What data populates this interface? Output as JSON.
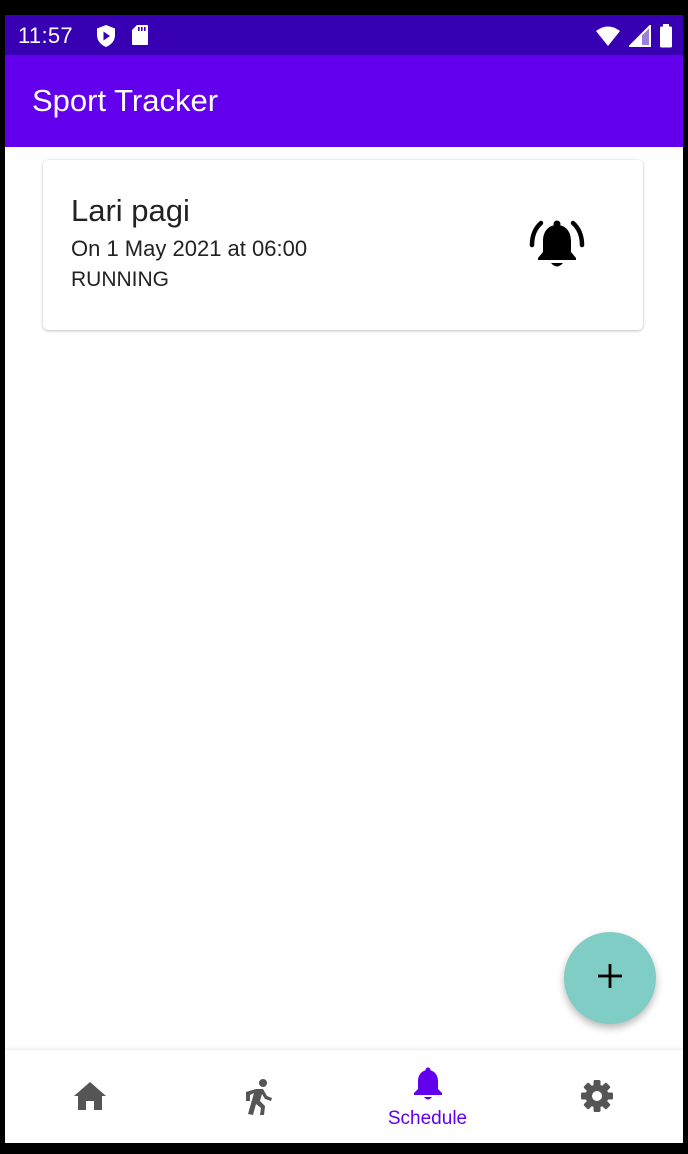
{
  "status_bar": {
    "time": "11:57",
    "icons": [
      "play-protect-icon",
      "sd-card-icon",
      "wifi-icon",
      "signal-icon",
      "battery-icon"
    ]
  },
  "app_bar": {
    "title": "Sport Tracker"
  },
  "schedule": {
    "items": [
      {
        "title": "Lari pagi",
        "date": "On 1 May 2021 at 06:00",
        "type": "RUNNING",
        "icon": "alarm-bell-icon"
      }
    ]
  },
  "fab": {
    "icon": "plus-icon"
  },
  "bottom_nav": {
    "items": [
      {
        "id": "home",
        "icon": "home-icon",
        "label": "",
        "selected": false
      },
      {
        "id": "run",
        "icon": "run-icon",
        "label": "",
        "selected": false
      },
      {
        "id": "schedule",
        "icon": "bell-icon",
        "label": "Schedule",
        "selected": true
      },
      {
        "id": "settings",
        "icon": "gear-icon",
        "label": "",
        "selected": false
      }
    ]
  },
  "colors": {
    "status_bar": "#3700b3",
    "primary": "#6200ee",
    "fab": "#7fcdc4",
    "nav_inactive": "#555555"
  }
}
